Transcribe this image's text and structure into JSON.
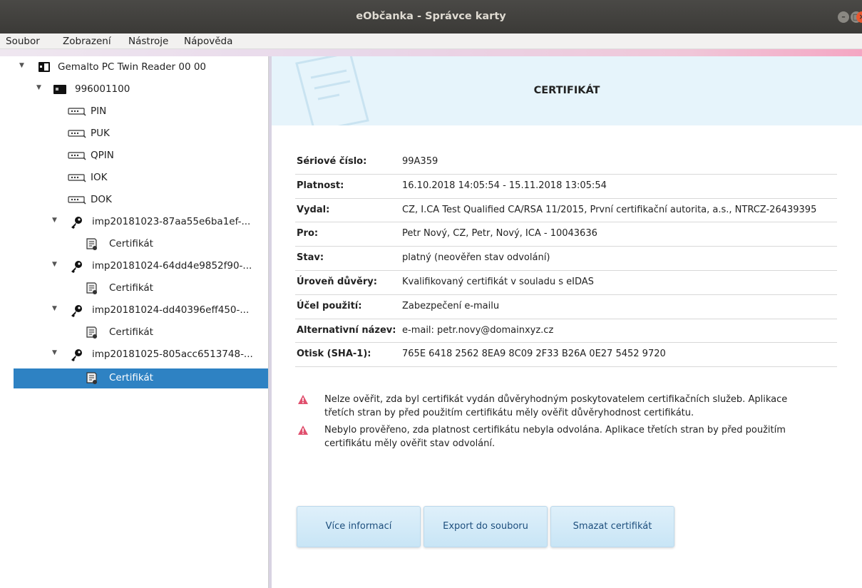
{
  "window": {
    "title": "eObčanka - Správce karty"
  },
  "menu": [
    {
      "label": "Soubor"
    },
    {
      "label": "Zobrazení"
    },
    {
      "label": "Nástroje"
    },
    {
      "label": "Nápověda"
    }
  ],
  "tree": {
    "reader": "Gemalto PC Twin Reader 00 00",
    "card": "996001100",
    "pins": [
      "PIN",
      "PUK",
      "QPIN",
      "IOK",
      "DOK"
    ],
    "keys": [
      {
        "name": "imp20181023-87aa55e6ba1ef-...",
        "child": "Certifikát"
      },
      {
        "name": "imp20181024-64dd4e9852f90-...",
        "child": "Certifikát"
      },
      {
        "name": "imp20181024-dd40396eff450-...",
        "child": "Certifikát"
      },
      {
        "name": "imp20181025-805acc6513748-...",
        "child": "Certifikát"
      }
    ]
  },
  "panel": {
    "title": "CERTIFIKÁT",
    "fields": [
      {
        "key": "Sériové číslo:",
        "value": "99A359"
      },
      {
        "key": "Platnost:",
        "value": "16.10.2018 14:05:54 - 15.11.2018 13:05:54"
      },
      {
        "key": "Vydal:",
        "value": "CZ, I.CA Test Qualified CA/RSA 11/2015, První certifikační autorita, a.s., NTRCZ-26439395"
      },
      {
        "key": "Pro:",
        "value": "Petr Nový, CZ, Petr, Nový, ICA - 10043636"
      },
      {
        "key": "Stav:",
        "value": "platný (neověřen stav odvolání)"
      },
      {
        "key": "Úroveň důvěry:",
        "value": "Kvalifikovaný certifikát v souladu s eIDAS"
      },
      {
        "key": "Účel použití:",
        "value": "Zabezpečení e-mailu"
      },
      {
        "key": "Alternativní název:",
        "value": "e-mail: petr.novy@domainxyz.cz"
      },
      {
        "key": "Otisk (SHA-1):",
        "value": "765E 6418 2562 8EA9 8C09 2F33 B26A 0E27 5452 9720"
      }
    ],
    "warnings": [
      "Nelze ověřit, zda byl certifikát vydán důvěryhodným poskytovatelem certifikačních služeb. Aplikace třetích stran by před použitím certifikátu měly ověřit důvěryhodnost certifikátu.",
      "Nebylo prověřeno, zda platnost certifikátu nebyla odvolána. Aplikace třetích stran by před použitím certifikátu měly ověřit stav odvolání."
    ],
    "buttons": {
      "more_info": "Více informací",
      "export": "Export do souboru",
      "delete": "Smazat certifikát"
    }
  },
  "colors": {
    "selection": "#2e82c3",
    "banner": "#e6f4fb",
    "warning": "#e0506e"
  }
}
